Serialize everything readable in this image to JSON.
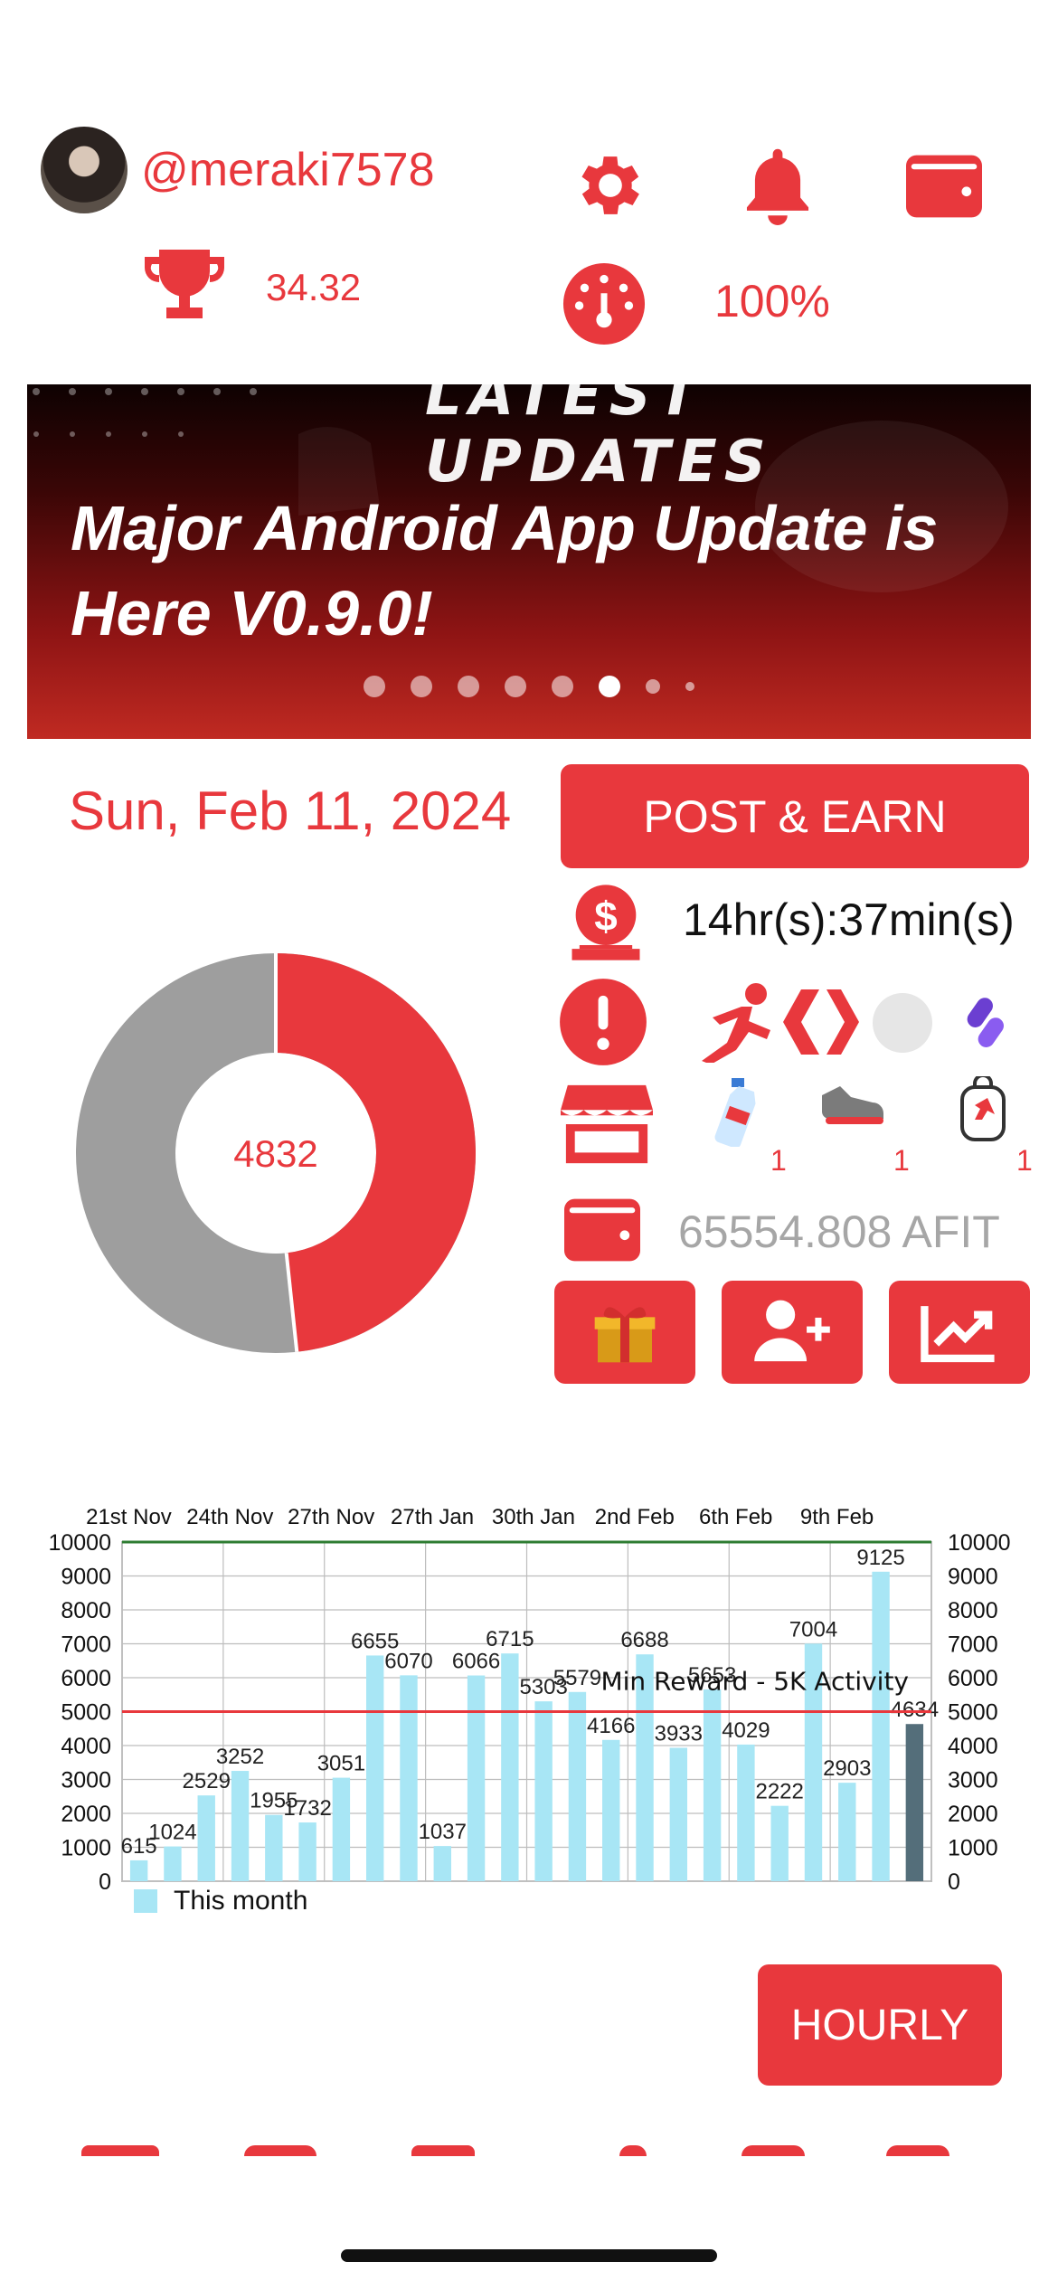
{
  "header": {
    "username": "@meraki7578",
    "trophy_value": "34.32",
    "speed_percent": "100%"
  },
  "icons": {
    "settings": "gear-icon",
    "notifications": "bell-icon",
    "wallet": "wallet-icon",
    "trophy": "trophy-icon",
    "gauge": "gauge-icon"
  },
  "banner": {
    "top_text": "LATEST UPDATES",
    "title": "Major Android App Update is Here V0.9.0!",
    "slides": 8,
    "active_slide": 6
  },
  "dashboard": {
    "date": "Sun, Feb 11, 2024",
    "donut_value": "4832",
    "post_earn_label": "POST & EARN",
    "timer": "14hr(s):37min(s)",
    "afit_balance": "65554.808 AFIT",
    "item_counts": [
      "1",
      "1",
      "1"
    ]
  },
  "donut": {
    "fraction_red": 0.4832,
    "colors": {
      "red": "#e8383d",
      "gray": "#9e9e9e"
    }
  },
  "chart_data": {
    "type": "bar",
    "x_tick_labels": [
      "21st Nov",
      "24th Nov",
      "27th Nov",
      "27th Jan",
      "30th Jan",
      "2nd Feb",
      "6th Feb",
      "9th Feb"
    ],
    "values": [
      615,
      1024,
      2529,
      3252,
      1955,
      1732,
      3051,
      6655,
      6070,
      1037,
      6066,
      6715,
      5303,
      5579,
      4166,
      6688,
      3933,
      5653,
      4029,
      2222,
      7004,
      2903,
      9125,
      4634
    ],
    "value_labels": [
      "615",
      "1024",
      "2529",
      "3252",
      "1955",
      "1732",
      "3051",
      "6655",
      "6070",
      "1037",
      "6066",
      "6715",
      "5303",
      "5579",
      "4166",
      "6688",
      "3933",
      "5653",
      "4029",
      "2222",
      "7004",
      "2903",
      "9125",
      "4634"
    ],
    "y_ticks": [
      0,
      1000,
      2000,
      3000,
      4000,
      5000,
      6000,
      7000,
      8000,
      9000,
      10000
    ],
    "ylim": [
      0,
      10000
    ],
    "lines": [
      {
        "value": 10000,
        "color": "#2e7d32"
      },
      {
        "value": 5000,
        "color": "#e8383d",
        "label": "Min Reward - 5K Activity"
      }
    ],
    "legend": "This month",
    "bar_color": "#a8e6f5",
    "last_bar_color": "#546e7a",
    "grid": true
  },
  "footer": {
    "hourly_label": "HOURLY"
  }
}
